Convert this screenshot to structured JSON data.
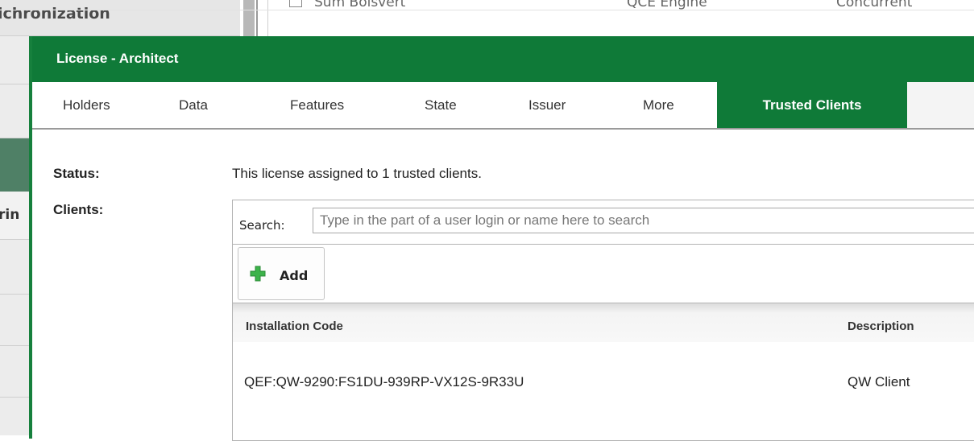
{
  "background": {
    "sidebar_title": "ichronization",
    "side_text": "rin",
    "top_row": {
      "name": "Sum Boisvert",
      "engine": "QCE Engine",
      "mode": "Concurrent"
    }
  },
  "dialog": {
    "title": "License - Architect",
    "tabs": [
      {
        "label": "Holders"
      },
      {
        "label": "Data"
      },
      {
        "label": "Features"
      },
      {
        "label": "State"
      },
      {
        "label": "Issuer"
      },
      {
        "label": "More"
      },
      {
        "label": "Trusted Clients",
        "active": true
      }
    ],
    "status_label": "Status:",
    "status_text": "This license assigned to 1 trusted clients.",
    "clients_label": "Clients:",
    "search": {
      "label": "Search:",
      "placeholder": "Type in the part of a user login or name here to search",
      "value": ""
    },
    "add_label": "Add",
    "table": {
      "columns": [
        "Installation Code",
        "Description"
      ],
      "rows": [
        [
          "QEF:QW-9290:FS1DU-939RP-VX12S-9R33U",
          "QW Client"
        ]
      ]
    }
  },
  "colors": {
    "primary_green": "#0f7a38",
    "add_icon_green": "#3cb34a"
  }
}
